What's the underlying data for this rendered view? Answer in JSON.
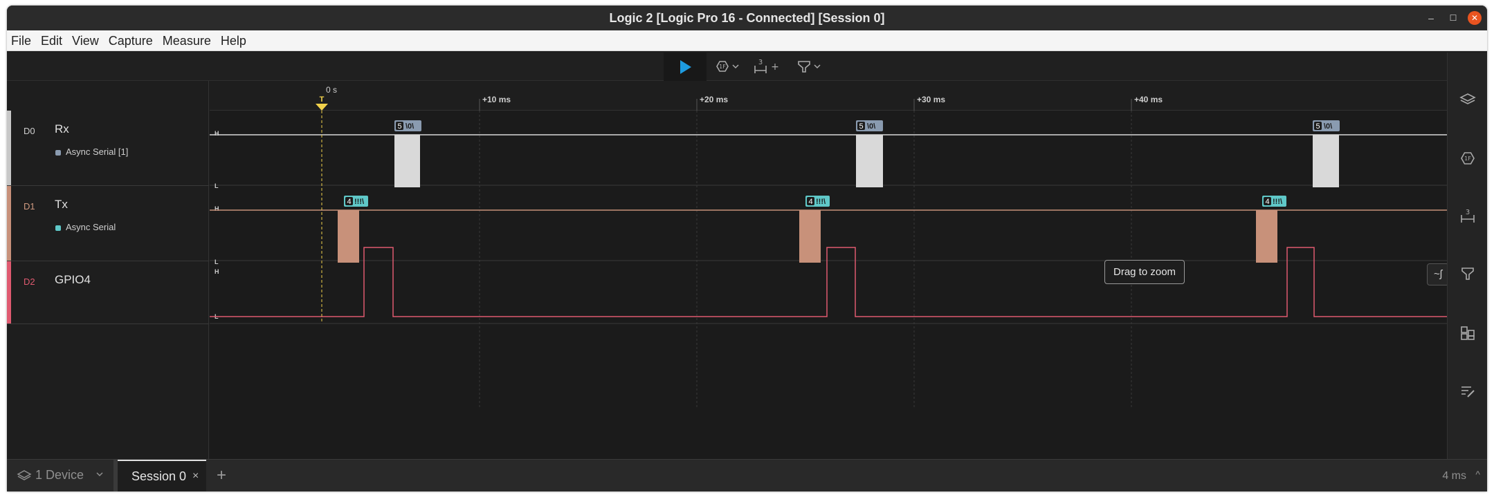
{
  "window": {
    "title": "Logic 2 [Logic Pro 16 - Connected] [Session 0]",
    "minimize": "–",
    "maximize": "☐",
    "close": "✕"
  },
  "menu": [
    "File",
    "Edit",
    "View",
    "Capture",
    "Measure",
    "Help"
  ],
  "toolbar": {
    "trigger_num": "3",
    "plus": "+",
    "caret": "⌄"
  },
  "timeline": {
    "zero_label": "0 s",
    "trigger_marker": "T",
    "ticks": [
      "+10 ms",
      "+20 ms",
      "+30 ms",
      "+40 ms"
    ]
  },
  "channels": [
    {
      "id": "D0",
      "name": "Rx",
      "analyzer": "Async Serial [1]",
      "color": "#c8c8c8",
      "analyzer_color": "#8a9bb0"
    },
    {
      "id": "D1",
      "name": "Tx",
      "analyzer": "Async Serial",
      "color": "#c8917a",
      "analyzer_color": "#5fc8c8"
    },
    {
      "id": "D2",
      "name": "GPIO4",
      "analyzer": "",
      "color": "#e05a70",
      "analyzer_color": ""
    }
  ],
  "level_labels": {
    "high": "H",
    "low": "L"
  },
  "rx_frames": [
    {
      "count": "5",
      "text": "\\0\\"
    },
    {
      "count": "5",
      "text": "\\0\\"
    },
    {
      "count": "5",
      "text": "\\0\\"
    }
  ],
  "tx_frames": [
    {
      "count": "4",
      "text": "!!!\\"
    },
    {
      "count": "4",
      "text": "!!!\\"
    },
    {
      "count": "4",
      "text": "!!!\\"
    }
  ],
  "tooltip": "Drag to zoom",
  "status": {
    "device": "1 Device",
    "session_tab": "Session 0",
    "session_close": "×",
    "add_tab": "+",
    "zoom": "4 ms",
    "caret": "^"
  },
  "side_button": "~ʃ",
  "colors": {
    "accent_play": "#1e9be0",
    "trigger": "#f2d24b",
    "rx": "#d9d9d9",
    "tx": "#c8917a",
    "gpio": "#e05a70",
    "frame_rx": "#8a9bb0",
    "frame_tx": "#5fc8c8"
  }
}
